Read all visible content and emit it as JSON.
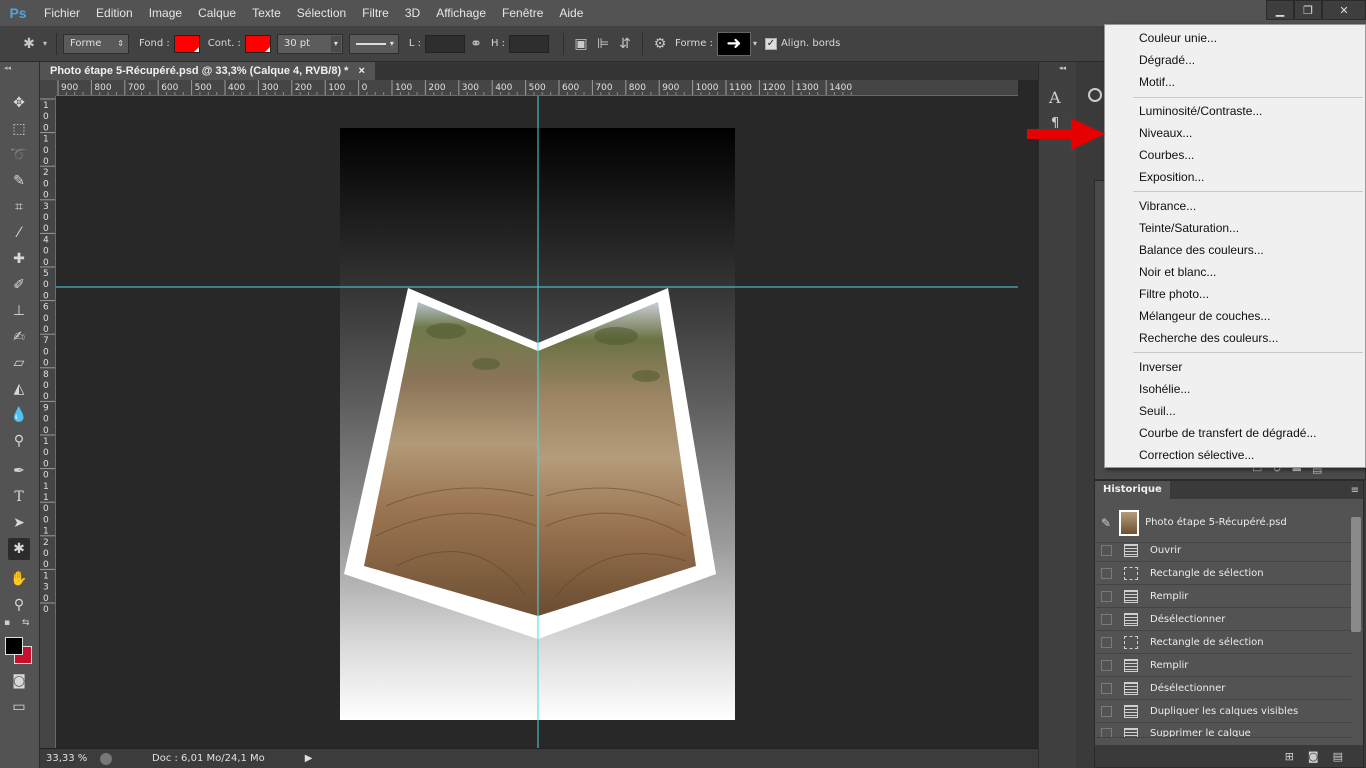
{
  "app": {
    "logo": "Ps",
    "menu": [
      "Fichier",
      "Edition",
      "Image",
      "Calque",
      "Texte",
      "Sélection",
      "Filtre",
      "3D",
      "Affichage",
      "Fenêtre",
      "Aide"
    ]
  },
  "options_bar": {
    "mode": "Forme",
    "fill_label": "Fond :",
    "stroke_label": "Cont. :",
    "stroke_size": "30 pt",
    "w_label": "L :",
    "h_label": "H :",
    "shape_label": "Forme :",
    "align_label": "Align. bords",
    "fill_color": "#ff0000",
    "stroke_color": "#ff0000"
  },
  "document": {
    "tab_title": "Photo étape 5-Récupéré.psd @ 33,3% (Calque 4, RVB/8) *",
    "close": "×"
  },
  "ruler_top": [
    "900",
    "800",
    "700",
    "600",
    "500",
    "400",
    "300",
    "200",
    "100",
    "0",
    "100",
    "200",
    "300",
    "400",
    "500",
    "600",
    "700",
    "800",
    "900",
    "1000",
    "1100",
    "1200",
    "1300",
    "1400"
  ],
  "ruler_left": [
    "1",
    "0",
    "0",
    "1",
    "0",
    "0",
    "2",
    "0",
    "0",
    "3",
    "0",
    "0",
    "4",
    "0",
    "0",
    "5",
    "0",
    "0",
    "6",
    "0",
    "0",
    "7",
    "0",
    "0",
    "8",
    "0",
    "0",
    "9",
    "0",
    "0",
    "1",
    "0",
    "0",
    "0",
    "1",
    "1",
    "0",
    "0",
    "1",
    "2",
    "0",
    "0",
    "1",
    "3",
    "0",
    "0"
  ],
  "status": {
    "zoom": "33,33 %",
    "doc_info": "Doc : 6,01 Mo/24,1 Mo"
  },
  "dropdown": {
    "group1": [
      "Couleur unie...",
      "Dégradé...",
      "Motif..."
    ],
    "group2": [
      "Luminosité/Contraste...",
      "Niveaux...",
      "Courbes...",
      "Exposition..."
    ],
    "group3": [
      "Vibrance...",
      "Teinte/Saturation...",
      "Balance des couleurs...",
      "Noir et blanc...",
      "Filtre photo...",
      "Mélangeur de couches...",
      "Recherche des couleurs..."
    ],
    "group4": [
      "Inverser",
      "Isohélie...",
      "Seuil...",
      "Courbe de transfert de dégradé...",
      "Correction sélective..."
    ]
  },
  "history": {
    "title": "Historique",
    "snapshot": "Photo étape 5-Récupéré.psd",
    "items": [
      "Ouvrir",
      "Rectangle de sélection",
      "Remplir",
      "Désélectionner",
      "Rectangle de sélection",
      "Remplir",
      "Désélectionner",
      "Dupliquer les calques visibles",
      "Supprimer le calque"
    ]
  },
  "colors": {
    "guide": "#4fd8e0",
    "arrow": "#e60000"
  }
}
